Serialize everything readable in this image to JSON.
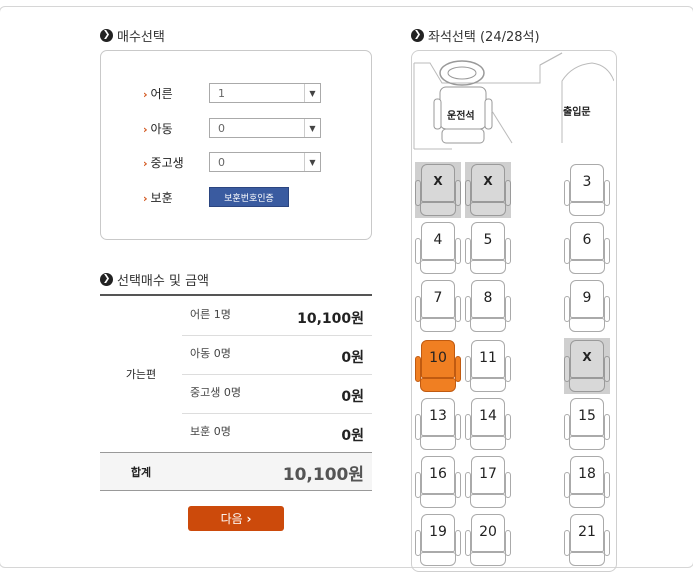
{
  "ticket": {
    "title": "매수선택",
    "rows": [
      {
        "label": "어른",
        "value": "1"
      },
      {
        "label": "아동",
        "value": "0"
      },
      {
        "label": "중고생",
        "value": "0"
      }
    ],
    "veteran_label": "보훈",
    "veteran_button": "보훈번호인증"
  },
  "summary": {
    "title": "선택매수 및 금액",
    "group": "가는편",
    "items": [
      {
        "name": "어른 1명",
        "amount": "10,100원"
      },
      {
        "name": "아동 0명",
        "amount": "0원"
      },
      {
        "name": "중고생 0명",
        "amount": "0원"
      },
      {
        "name": "보훈 0명",
        "amount": "0원"
      }
    ],
    "total_label": "합계",
    "total_amount": "10,100원",
    "next_label": "다음"
  },
  "seats_panel": {
    "title": "좌석선택 (24/28석)",
    "driver_label": "운전석",
    "door_label": "출입문",
    "seats": [
      {
        "label": "X",
        "state": "sold"
      },
      {
        "label": "X",
        "state": "sold"
      },
      {
        "label": "3",
        "state": "available"
      },
      {
        "label": "4",
        "state": "available"
      },
      {
        "label": "5",
        "state": "available"
      },
      {
        "label": "6",
        "state": "available"
      },
      {
        "label": "7",
        "state": "available"
      },
      {
        "label": "8",
        "state": "available"
      },
      {
        "label": "9",
        "state": "available"
      },
      {
        "label": "10",
        "state": "selected"
      },
      {
        "label": "11",
        "state": "available"
      },
      {
        "label": "X",
        "state": "sold"
      },
      {
        "label": "13",
        "state": "available"
      },
      {
        "label": "14",
        "state": "available"
      },
      {
        "label": "15",
        "state": "available"
      },
      {
        "label": "16",
        "state": "available"
      },
      {
        "label": "17",
        "state": "available"
      },
      {
        "label": "18",
        "state": "available"
      },
      {
        "label": "19",
        "state": "available"
      },
      {
        "label": "20",
        "state": "available"
      },
      {
        "label": "21",
        "state": "available"
      }
    ]
  },
  "colors": {
    "accent": "#cc4a0b",
    "selected_seat": "#f07f22",
    "button_blue": "#3a5ba0"
  }
}
